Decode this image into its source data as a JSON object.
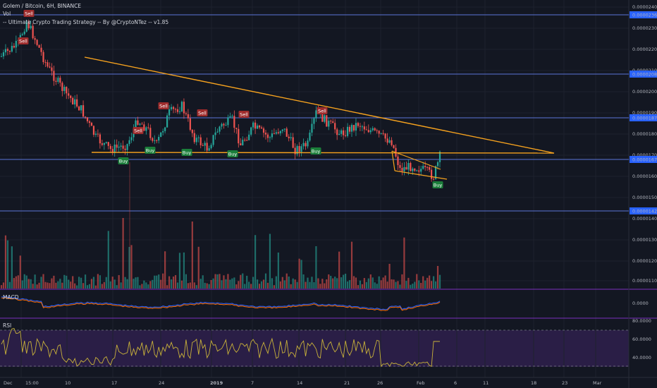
{
  "header": {
    "symbol": "Golem / Bitcoin, 6H, BINANCE",
    "vol_label": "Vol",
    "strategy": "-- Ultimate Crypto Trading Strategy -- By @CryptoNTez -- v1.85"
  },
  "panes": {
    "macd_label": "MACD",
    "rsi_label": "RSI"
  },
  "price_axis": {
    "ticks": [
      "0.00002400",
      "0.00002300",
      "0.00002200",
      "0.00002100",
      "0.00002000",
      "0.00001900",
      "0.00001800",
      "0.00001700",
      "0.00001600",
      "0.00001500",
      "0.00001400",
      "0.00001300",
      "0.00001200",
      "0.00001100"
    ],
    "highlighted": [
      "0.00002368",
      "0.00002084",
      "0.00001877",
      "0.00001675",
      "0.00001422"
    ],
    "macd_tick": "0.0000",
    "rsi_ticks": [
      "80.0000",
      "60.0000",
      "40.0000"
    ]
  },
  "time_axis": [
    "Dec",
    "15:00",
    "10",
    "17",
    "24",
    "2019",
    "7",
    "14",
    "21",
    "26",
    "Feb",
    "6",
    "11",
    "18",
    "23",
    "Mar"
  ],
  "signals": [
    {
      "label": "Sell",
      "type": "sell"
    },
    {
      "label": "Sell",
      "type": "sell"
    },
    {
      "label": "Sell",
      "type": "sell"
    },
    {
      "label": "Sell",
      "type": "sell"
    },
    {
      "label": "Sell",
      "type": "sell"
    },
    {
      "label": "Sell",
      "type": "sell"
    },
    {
      "label": "Sell",
      "type": "sell"
    },
    {
      "label": "Buy",
      "type": "buy"
    },
    {
      "label": "Buy",
      "type": "buy"
    },
    {
      "label": "Buy",
      "type": "buy"
    },
    {
      "label": "Buy",
      "type": "buy"
    },
    {
      "label": "Buy",
      "type": "buy"
    },
    {
      "label": "Buy",
      "type": "buy"
    }
  ],
  "colors": {
    "background": "#131722",
    "grid": "#1e222d",
    "up": "#26a69a",
    "down": "#ef5350",
    "trendline": "#f6a21e",
    "level_line": "#5b74d8",
    "macd": "#2962ff",
    "signal": "#ff6d00",
    "rsi": "#c9b23a",
    "rsi_band": "#2a1e46",
    "pane_divider": "#7b2fbe"
  }
}
